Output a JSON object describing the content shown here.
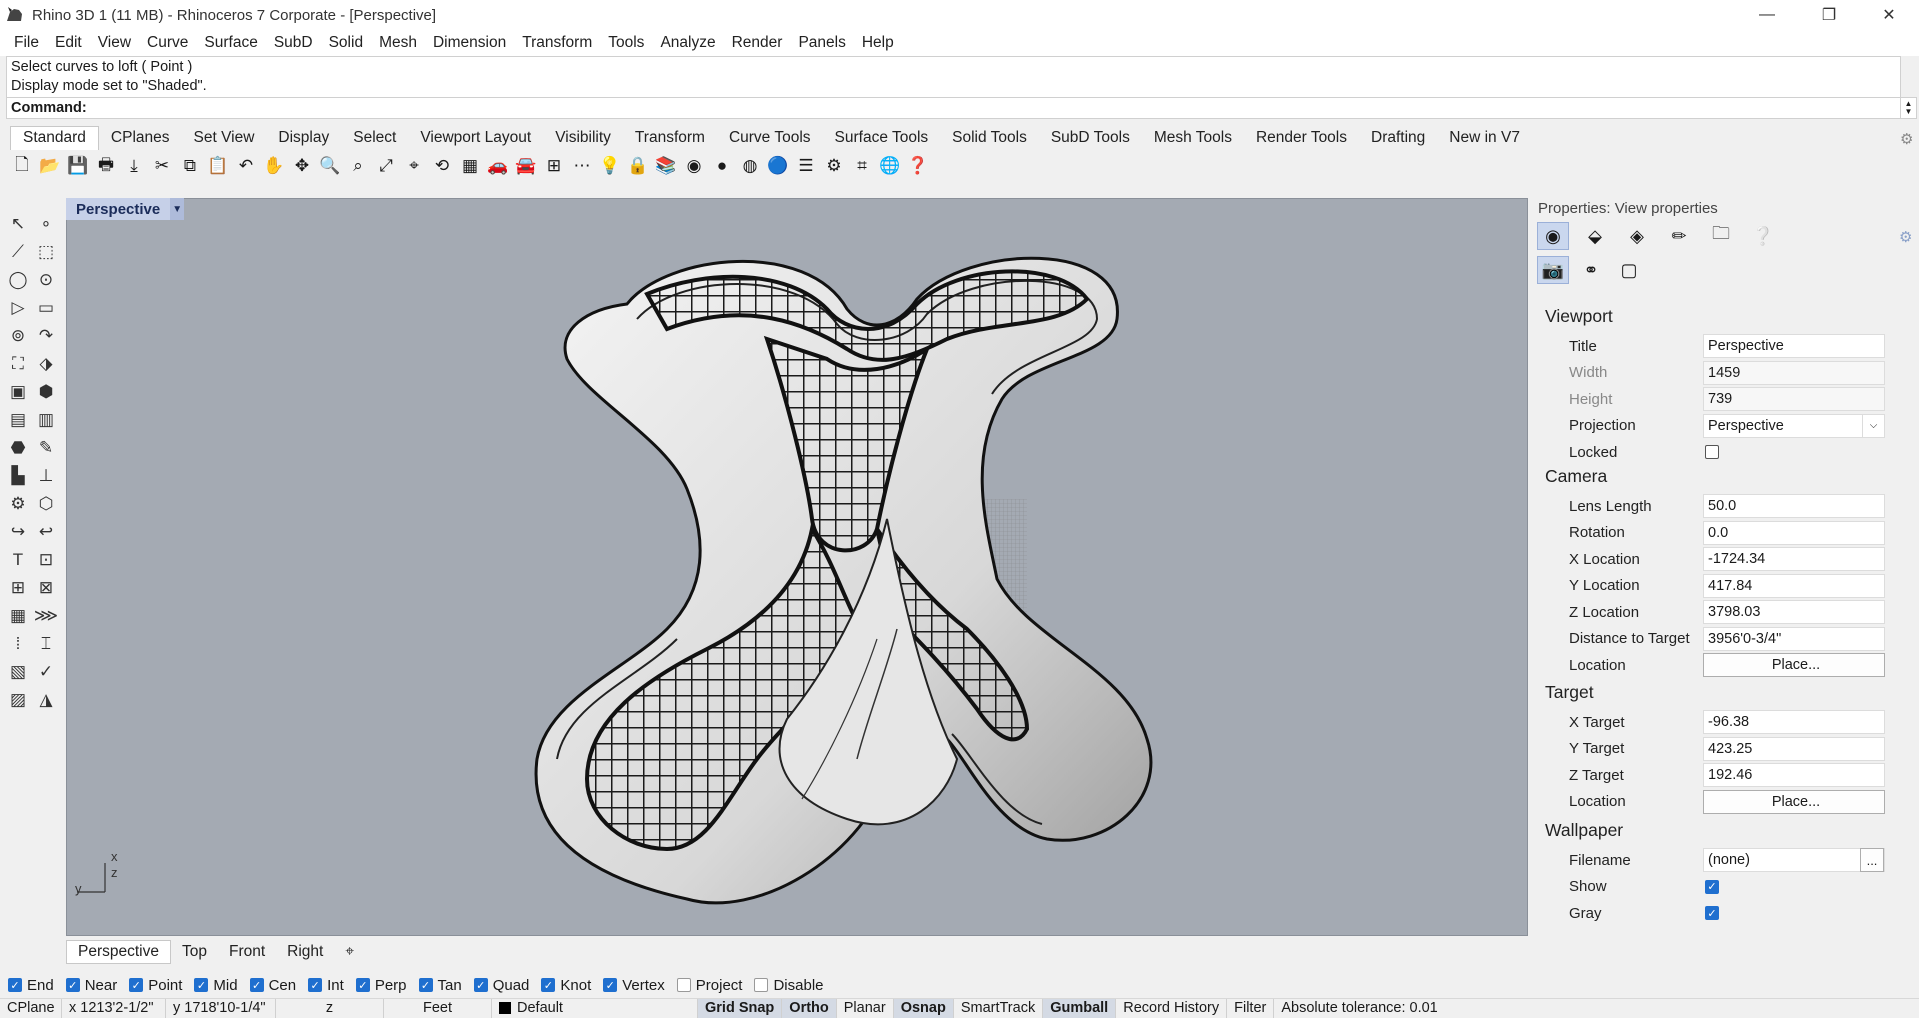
{
  "window": {
    "title": "Rhino 3D 1 (11 MB) - Rhinoceros 7 Corporate - [Perspective]",
    "minimize": "—",
    "maximize": "❐",
    "close": "✕"
  },
  "menu": [
    "File",
    "Edit",
    "View",
    "Curve",
    "Surface",
    "SubD",
    "Solid",
    "Mesh",
    "Dimension",
    "Transform",
    "Tools",
    "Analyze",
    "Render",
    "Panels",
    "Help"
  ],
  "command": {
    "history": [
      "Select curves to loft ( Point )",
      "Display mode set to \"Shaded\"."
    ],
    "prompt": "Command:",
    "value": ""
  },
  "toolbar_tabs": [
    "Standard",
    "CPlanes",
    "Set View",
    "Display",
    "Select",
    "Viewport Layout",
    "Visibility",
    "Transform",
    "Curve Tools",
    "Surface Tools",
    "Solid Tools",
    "SubD Tools",
    "Mesh Tools",
    "Render Tools",
    "Drafting",
    "New in V7"
  ],
  "toolbar_icons": [
    "new-icon",
    "open-icon",
    "save-icon",
    "print-icon",
    "import-icon",
    "cut-icon",
    "copy-icon",
    "paste-icon",
    "undo-icon",
    "pan-icon",
    "move-view-icon",
    "zoom-icon",
    "zoom-window-icon",
    "zoom-extents-icon",
    "zoom-selected-icon",
    "rotate-view-icon",
    "four-viewports-icon",
    "car-icon",
    "shaded-car-icon",
    "grid-icon",
    "snap-icon",
    "light-icon",
    "lock-icon",
    "layer-icon",
    "color-wheel-icon",
    "sphere-icon",
    "render-sphere-icon",
    "blue-sphere-icon",
    "properties-icon",
    "gear-icon",
    "osnap-icon",
    "globe-icon",
    "help-icon"
  ],
  "toolbar_glyphs": [
    "🗋",
    "📂",
    "💾",
    "🖶",
    "⤓",
    "✂",
    "⧉",
    "📋",
    "↶",
    "✋",
    "✥",
    "🔍",
    "⌕",
    "⤢",
    "⌖",
    "⟲",
    "▦",
    "🚗",
    "🚘",
    "⊞",
    "⋯",
    "💡",
    "🔒",
    "📚",
    "◉",
    "●",
    "◍",
    "🔵",
    "☰",
    "⚙",
    "⌗",
    "🌐",
    "❓"
  ],
  "left_tools": [
    "↖",
    "∘",
    "⟋",
    "⬚",
    "◯",
    "⊙",
    "▷",
    "▭",
    "⊚",
    "↷",
    "⛶",
    "⬗",
    "▣",
    "⬢",
    "▤",
    "▥",
    "⬣",
    "✎",
    "▙",
    "⊥",
    "⚙",
    "⬡",
    "↪",
    "↩",
    "T",
    "⊡",
    "⊞",
    "⊠",
    "▦",
    "⋙",
    "⁞",
    "⌶",
    "▧",
    "✓",
    "▨",
    "◮"
  ],
  "viewport": {
    "label": "Perspective",
    "axis_x": "x",
    "axis_y": "y",
    "axis_z": "z",
    "tabs": [
      "Perspective",
      "Top",
      "Front",
      "Right"
    ],
    "add_tab": "⌖"
  },
  "properties": {
    "header": "Properties: View properties",
    "tabs_row1": [
      "color-wheel-icon",
      "material-icon",
      "render-icon",
      "brush-icon",
      "folder-icon",
      "help-panel-icon"
    ],
    "tabs_row1_glyphs": [
      "◉",
      "⬙",
      "◈",
      "✏",
      "🗀",
      "❔"
    ],
    "tabs_row2": [
      "camera-icon",
      "named-views-icon",
      "frame-icon"
    ],
    "tabs_row2_glyphs": [
      "📷",
      "⚭",
      "▢"
    ],
    "viewport": {
      "title": "Viewport",
      "rows": [
        {
          "label": "Title",
          "value": "Perspective"
        },
        {
          "label": "Width",
          "value": "1459"
        },
        {
          "label": "Height",
          "value": "739"
        },
        {
          "label": "Projection",
          "value": "Perspective"
        },
        {
          "label": "Locked",
          "value": ""
        }
      ]
    },
    "camera": {
      "title": "Camera",
      "rows": [
        {
          "label": "Lens Length",
          "value": "50.0"
        },
        {
          "label": "Rotation",
          "value": "0.0"
        },
        {
          "label": "X Location",
          "value": "-1724.34"
        },
        {
          "label": "Y Location",
          "value": "417.84"
        },
        {
          "label": "Z Location",
          "value": "3798.03"
        },
        {
          "label": "Distance to Target",
          "value": "3956'0-3/4\""
        },
        {
          "label": "Location",
          "value": "Place..."
        }
      ]
    },
    "target": {
      "title": "Target",
      "rows": [
        {
          "label": "X Target",
          "value": "-96.38"
        },
        {
          "label": "Y Target",
          "value": "423.25"
        },
        {
          "label": "Z Target",
          "value": "192.46"
        },
        {
          "label": "Location",
          "value": "Place..."
        }
      ]
    },
    "wallpaper": {
      "title": "Wallpaper",
      "rows": [
        {
          "label": "Filename",
          "value": "(none)"
        },
        {
          "label": "Show",
          "value": ""
        },
        {
          "label": "Gray",
          "value": ""
        }
      ],
      "browse": "..."
    }
  },
  "osnaps": [
    {
      "label": "End",
      "checked": true
    },
    {
      "label": "Near",
      "checked": true
    },
    {
      "label": "Point",
      "checked": true
    },
    {
      "label": "Mid",
      "checked": true
    },
    {
      "label": "Cen",
      "checked": true
    },
    {
      "label": "Int",
      "checked": true
    },
    {
      "label": "Perp",
      "checked": true
    },
    {
      "label": "Tan",
      "checked": true
    },
    {
      "label": "Quad",
      "checked": true
    },
    {
      "label": "Knot",
      "checked": true
    },
    {
      "label": "Vertex",
      "checked": true
    },
    {
      "label": "Project",
      "checked": false
    },
    {
      "label": "Disable",
      "checked": false
    }
  ],
  "status": {
    "cplane": "CPlane",
    "x": "x 1213'2-1/2\"",
    "y": "y 1718'10-1/4\"",
    "z": "z",
    "units": "Feet",
    "layer": "Default",
    "grid_snap": "Grid Snap",
    "ortho": "Ortho",
    "planar": "Planar",
    "osnap": "Osnap",
    "smarttrack": "SmartTrack",
    "gumball": "Gumball",
    "record_history": "Record History",
    "filter": "Filter",
    "tolerance": "Absolute tolerance: 0.01"
  },
  "colors": {
    "viewport_bg": "#a4aab3",
    "label_bg": "#c6d0e8",
    "check_blue": "#1f6fcf"
  }
}
